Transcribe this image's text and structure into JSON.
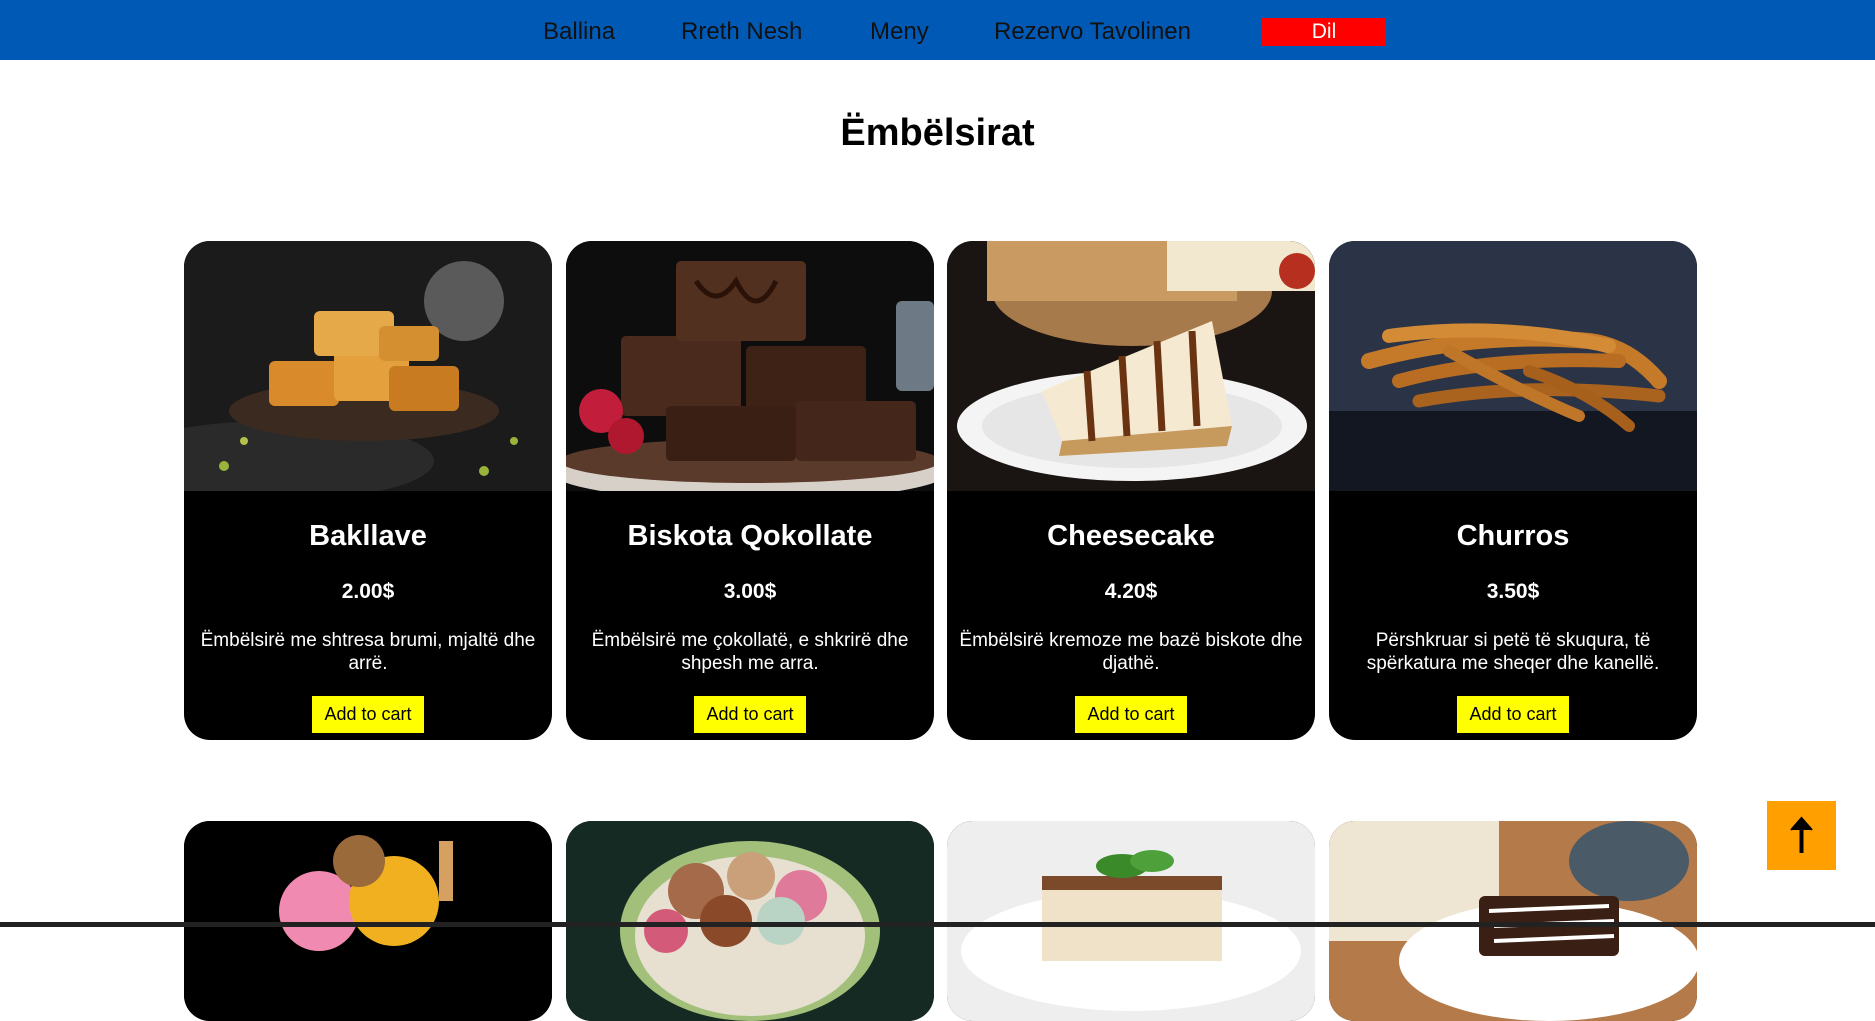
{
  "nav": {
    "items": [
      "Ballina",
      "Rreth Nesh",
      "Meny",
      "Rezervo Tavolinen"
    ],
    "language_label": "Dil",
    "colors": {
      "bar": "#005ab5",
      "language_button": "#ff0000"
    }
  },
  "page": {
    "title": "Ëmbëlsirat"
  },
  "products": [
    {
      "name": "Bakllave",
      "price": "2.00$",
      "description": "Ëmbëlsirë me shtresa brumi, mjaltë dhe arrë.",
      "button": "Add to cart",
      "image": "baklava-image"
    },
    {
      "name": "Biskota Qokollate",
      "price": "3.00$",
      "description": "Ëmbëlsirë me çokollatë, e shkrirë dhe shpesh me arra.",
      "button": "Add to cart",
      "image": "brownies-image"
    },
    {
      "name": "Cheesecake",
      "price": "4.20$",
      "description": "Ëmbëlsirë kremoze me bazë biskote dhe djathë.",
      "button": "Add to cart",
      "image": "cheesecake-image"
    },
    {
      "name": "Churros",
      "price": "3.50$",
      "description": "Përshkruar si petë të skuqura, të spërkatura me sheqer dhe kanellë.",
      "button": "Add to cart",
      "image": "churros-image"
    }
  ],
  "next_row_images": [
    "ice-cream-image",
    "macarons-image",
    "tiramisu-image",
    "chocolate-dessert-image"
  ],
  "scroll_top": {
    "icon": "arrow-up-icon",
    "color": "#ffa000"
  },
  "accent_colors": {
    "card": "#000000",
    "cart_button": "#ffff00"
  }
}
